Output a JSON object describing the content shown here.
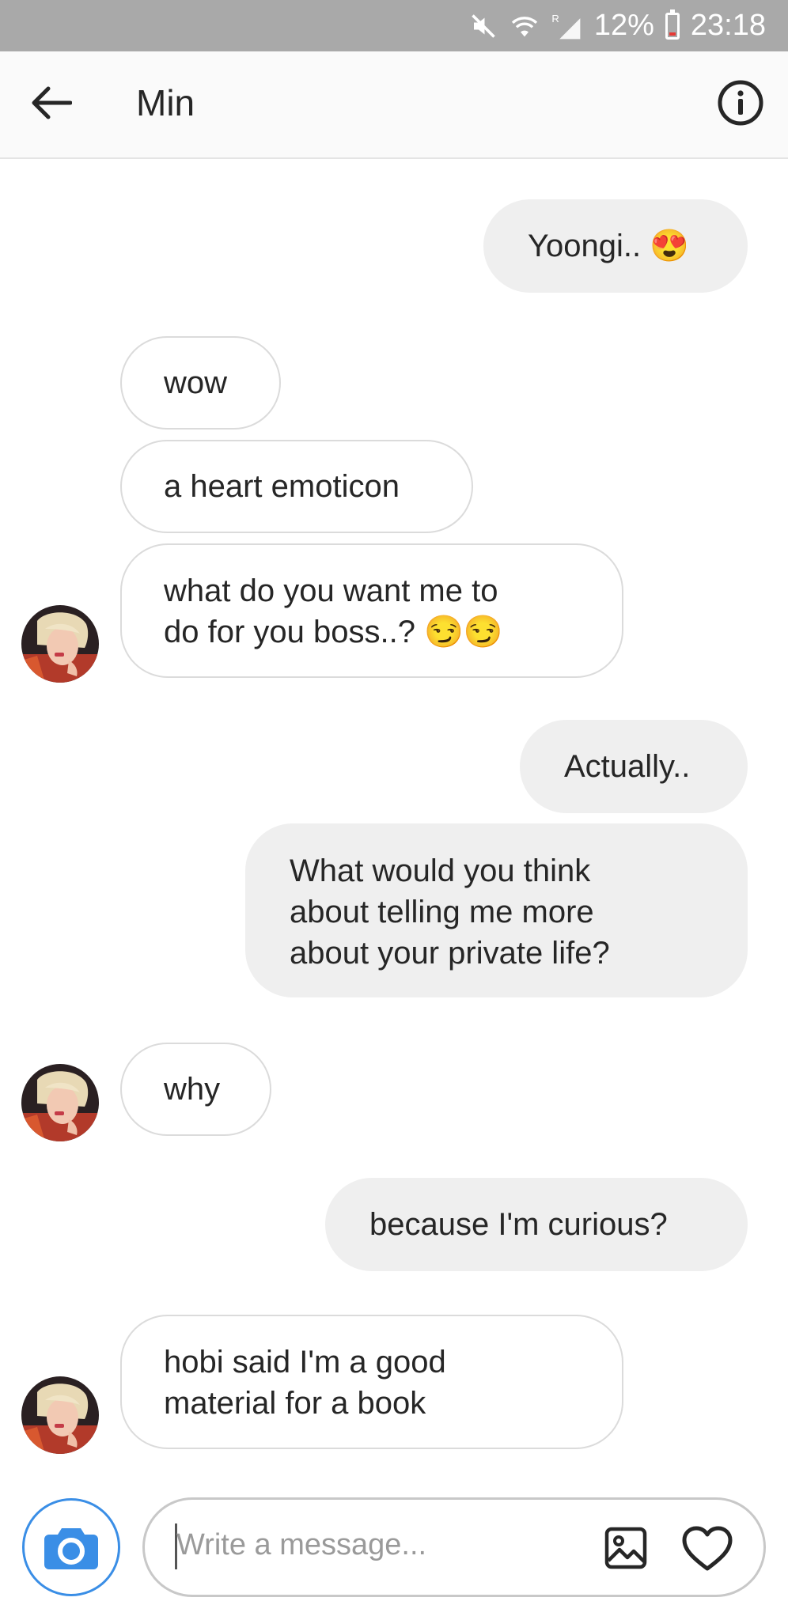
{
  "status_bar": {
    "battery": "12%",
    "time": "23:18",
    "network_tag": "R"
  },
  "header": {
    "title": "Min",
    "back_icon": "arrow-left-icon",
    "info_icon": "info-icon"
  },
  "messages": [
    {
      "side": "out",
      "text": "Yoongi.. 😍"
    },
    {
      "side": "in",
      "text": "wow"
    },
    {
      "side": "in",
      "text": "a heart emoticon"
    },
    {
      "side": "in",
      "lines": [
        "what do you want me to",
        "do for you boss..? 😏😏"
      ]
    },
    {
      "side": "out",
      "text": "Actually.."
    },
    {
      "side": "out",
      "lines": [
        "What would you think",
        "about telling me more",
        "about your private life?"
      ]
    },
    {
      "side": "in",
      "text": "why"
    },
    {
      "side": "out",
      "text": "because I'm curious?"
    },
    {
      "side": "in",
      "lines": [
        "hobi said I'm a good",
        "material for a book"
      ]
    }
  ],
  "composer": {
    "placeholder": "Write a message...",
    "camera_icon": "camera-icon",
    "gallery_icon": "gallery-icon",
    "like_icon": "heart-icon"
  },
  "colors": {
    "status_bar": "#a9a9a9",
    "outgoing_bubble": "#efefef",
    "incoming_border": "#dbdbdb",
    "camera_accent": "#3a8ee6"
  }
}
